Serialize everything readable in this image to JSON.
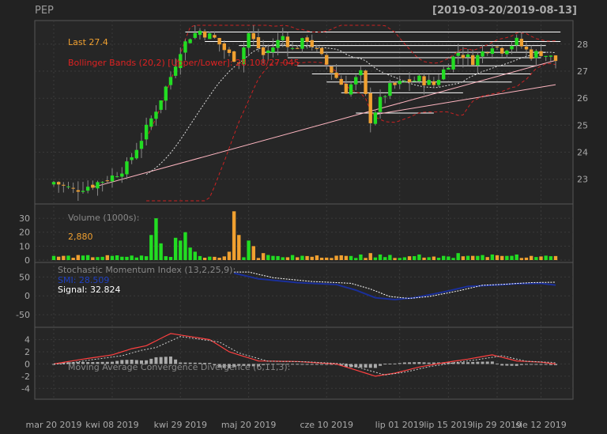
{
  "header": {
    "symbol": "PEP",
    "date_range": "[2019-03-20/2019-08-13]"
  },
  "colors": {
    "background": "#222222",
    "panel": "#2a2a2a",
    "grid": "#3a3a3a",
    "up": "#22dd22",
    "down": "#f0a030",
    "bb": "#cc2222",
    "ma": "#dddddd",
    "trend": "#ffb6c1",
    "smi": "#1a2f9a",
    "signal": "#ffffff",
    "macd": "#ff4040",
    "hist": "#aaaaaa",
    "text_gray": "#888888"
  },
  "x_labels": [
    "mar 20 2019",
    "kwi 08 2019",
    "kwi 29 2019",
    "maj 20 2019",
    "cze 10 2019",
    "lip 01 2019",
    "lip 15 2019",
    "lip 29 2019",
    "sie 12 2019"
  ],
  "x_label_index": [
    0,
    12,
    26,
    40,
    56,
    71,
    81,
    91,
    100
  ],
  "price_panel": {
    "last_label": "Last 27.4",
    "bb_label": "Bollinger Bands (20,2) [Upper/Lower]: 28.108/27.045",
    "y_ticks": [
      23,
      24,
      25,
      26,
      27,
      28
    ],
    "ylim": [
      22.2,
      28.7
    ]
  },
  "volume_panel": {
    "label": "Volume (1000s):",
    "value": "2,880",
    "y_ticks": [
      0,
      10,
      20,
      30
    ],
    "ylim": [
      0,
      38
    ]
  },
  "smi_panel": {
    "label": "Stochastic Momentum Index (13,2,25,9):",
    "smi_label": "SMI: 28.509",
    "signal_label": "Signal: 32.824",
    "y_ticks": [
      -50,
      0,
      50
    ],
    "ylim": [
      -75,
      80
    ]
  },
  "macd_panel": {
    "label": "Moving Average Convergence Divergence (6,11,3):",
    "y_ticks": [
      -4,
      -2,
      0,
      2,
      4
    ],
    "ylim": [
      -5,
      5.5
    ]
  },
  "chart_data": {
    "type": "candlestick",
    "n_days": 104,
    "anchors_close": [
      [
        0,
        22.9
      ],
      [
        4,
        22.6
      ],
      [
        8,
        22.8
      ],
      [
        12,
        23.1
      ],
      [
        15,
        23.5
      ],
      [
        18,
        24.5
      ],
      [
        21,
        25.6
      ],
      [
        24,
        26.8
      ],
      [
        26,
        27.8
      ],
      [
        28,
        28.3
      ],
      [
        30,
        28.5
      ],
      [
        33,
        28.2
      ],
      [
        36,
        27.6
      ],
      [
        38,
        27.4
      ],
      [
        40,
        28.4
      ],
      [
        43,
        27.6
      ],
      [
        45,
        27.9
      ],
      [
        47,
        28.3
      ],
      [
        49,
        27.8
      ],
      [
        52,
        28.2
      ],
      [
        55,
        27.5
      ],
      [
        57,
        27.0
      ],
      [
        60,
        26.3
      ],
      [
        63,
        26.9
      ],
      [
        65,
        25.2
      ],
      [
        67,
        25.9
      ],
      [
        69,
        26.4
      ],
      [
        72,
        26.6
      ],
      [
        75,
        26.7
      ],
      [
        78,
        26.5
      ],
      [
        81,
        27.3
      ],
      [
        83,
        27.7
      ],
      [
        86,
        27.4
      ],
      [
        90,
        28.0
      ],
      [
        92,
        27.8
      ],
      [
        95,
        28.1
      ],
      [
        98,
        27.6
      ],
      [
        100,
        27.7
      ],
      [
        103,
        27.4
      ]
    ],
    "volume_spikes": {
      "0": 3,
      "20": 18,
      "21": 30,
      "22": 12,
      "25": 16,
      "26": 14,
      "27": 20,
      "28": 9,
      "29": 6,
      "36": 6,
      "37": 35,
      "38": 18,
      "40": 14,
      "41": 10,
      "43": 5,
      "45": 3,
      "60": 3,
      "63": 4,
      "65": 5,
      "67": 4,
      "75": 4,
      "80": 3,
      "83": 5,
      "87": 3,
      "90": 4,
      "93": 3,
      "95": 4,
      "98": 3,
      "103": 2.9
    },
    "smi_anchors": [
      [
        37,
        60
      ],
      [
        42,
        45
      ],
      [
        50,
        35
      ],
      [
        58,
        30
      ],
      [
        62,
        15
      ],
      [
        66,
        -5
      ],
      [
        70,
        -10
      ],
      [
        74,
        -5
      ],
      [
        80,
        10
      ],
      [
        85,
        25
      ],
      [
        90,
        28
      ],
      [
        95,
        32
      ],
      [
        100,
        33
      ],
      [
        103,
        28.5
      ]
    ],
    "macd_anchors": [
      [
        0,
        0
      ],
      [
        6,
        0.8
      ],
      [
        12,
        1.5
      ],
      [
        16,
        2.5
      ],
      [
        19,
        3
      ],
      [
        24,
        5
      ],
      [
        28,
        4.5
      ],
      [
        32,
        4
      ],
      [
        36,
        2
      ],
      [
        42,
        0.5
      ],
      [
        50,
        0.4
      ],
      [
        58,
        0
      ],
      [
        62,
        -1
      ],
      [
        66,
        -2
      ],
      [
        70,
        -1.5
      ],
      [
        75,
        -0.5
      ],
      [
        80,
        0.2
      ],
      [
        85,
        0.8
      ],
      [
        90,
        1.5
      ],
      [
        95,
        0.5
      ],
      [
        100,
        0.3
      ],
      [
        103,
        0
      ]
    ]
  }
}
